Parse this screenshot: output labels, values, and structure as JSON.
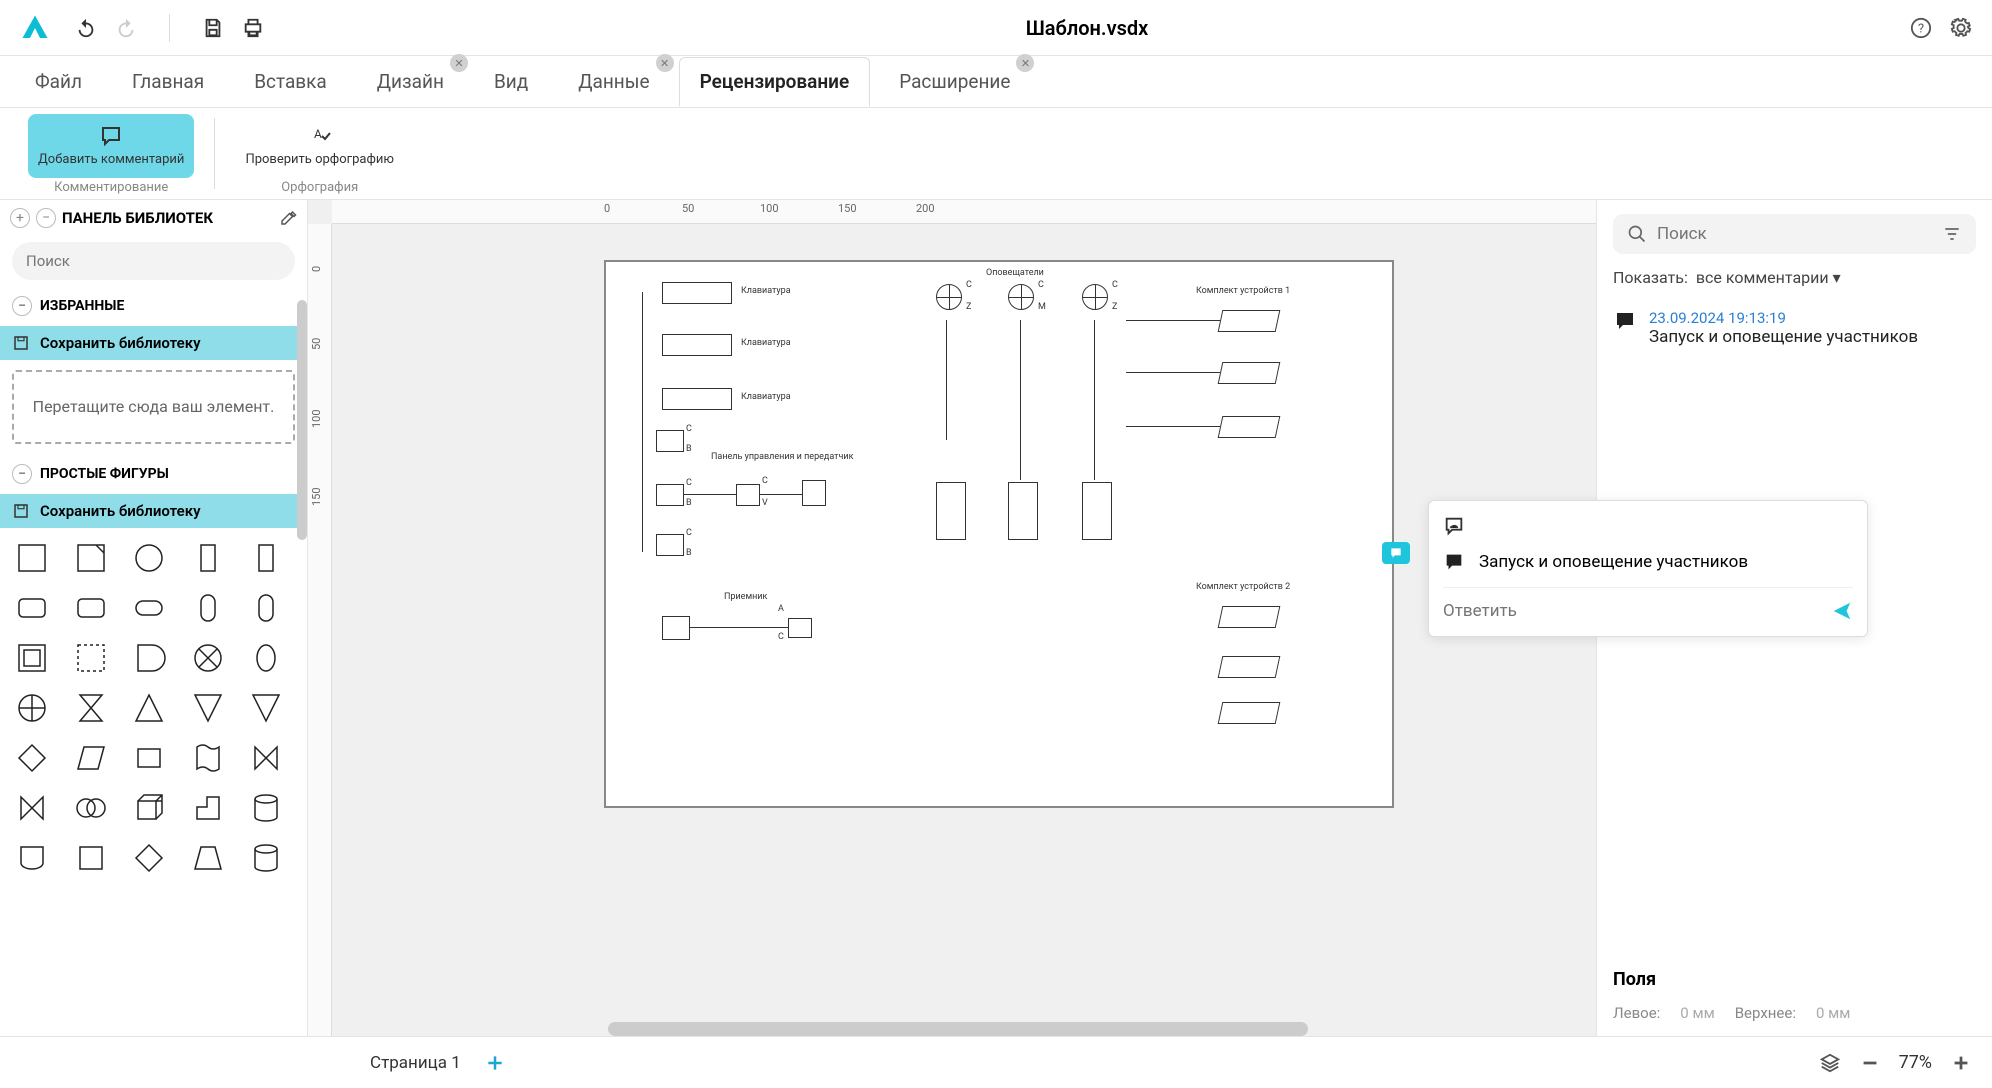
{
  "header": {
    "title": "Шаблон.vsdx"
  },
  "menu": {
    "items": [
      "Файл",
      "Главная",
      "Вставка",
      "Дизайн",
      "Вид",
      "Данные",
      "Рецензирование",
      "Расширение"
    ],
    "active_index": 6
  },
  "ribbon": {
    "add_comment": "Добавить комментарий",
    "spell_check": "Проверить орфографию",
    "group_comment": "Комментирование",
    "group_spell": "Орфография"
  },
  "sidebar": {
    "title": "ПАНЕЛЬ БИБЛИОТЕК",
    "search_placeholder": "Поиск",
    "favorites": "ИЗБРАННЫЕ",
    "save_library": "Сохранить библиотеку",
    "drop_hint": "Перетащите сюда ваш элемент.",
    "simple_shapes": "ПРОСТЫЕ ФИГУРЫ"
  },
  "ruler_h": [
    "0",
    "50",
    "100",
    "150",
    "200"
  ],
  "ruler_v": [
    "0",
    "50",
    "100",
    "150"
  ],
  "diagram": {
    "labels": {
      "keyboard": "Клавиатура",
      "panel": "Панель управления и передатчик",
      "receiver": "Приемник",
      "announcers": "Оповещатели",
      "kit1": "Комплект устройств 1",
      "kit2": "Комплект устройств 2"
    },
    "pins": {
      "c": "C",
      "z": "Z",
      "m": "M",
      "b": "B",
      "v": "V",
      "a": "A"
    }
  },
  "comments": {
    "search_placeholder": "Поиск",
    "show_label": "Показать:",
    "show_value": "все комментарии",
    "item": {
      "date": "23.09.2024 19:13:19",
      "text": "Запуск и оповещение участников"
    },
    "reply_placeholder": "Ответить"
  },
  "fields": {
    "header": "Поля",
    "left_label": "Левое:",
    "left_value": "0 мм",
    "top_label": "Верхнее:",
    "top_value": "0 мм"
  },
  "status": {
    "page": "Страница 1",
    "zoom": "77%"
  }
}
